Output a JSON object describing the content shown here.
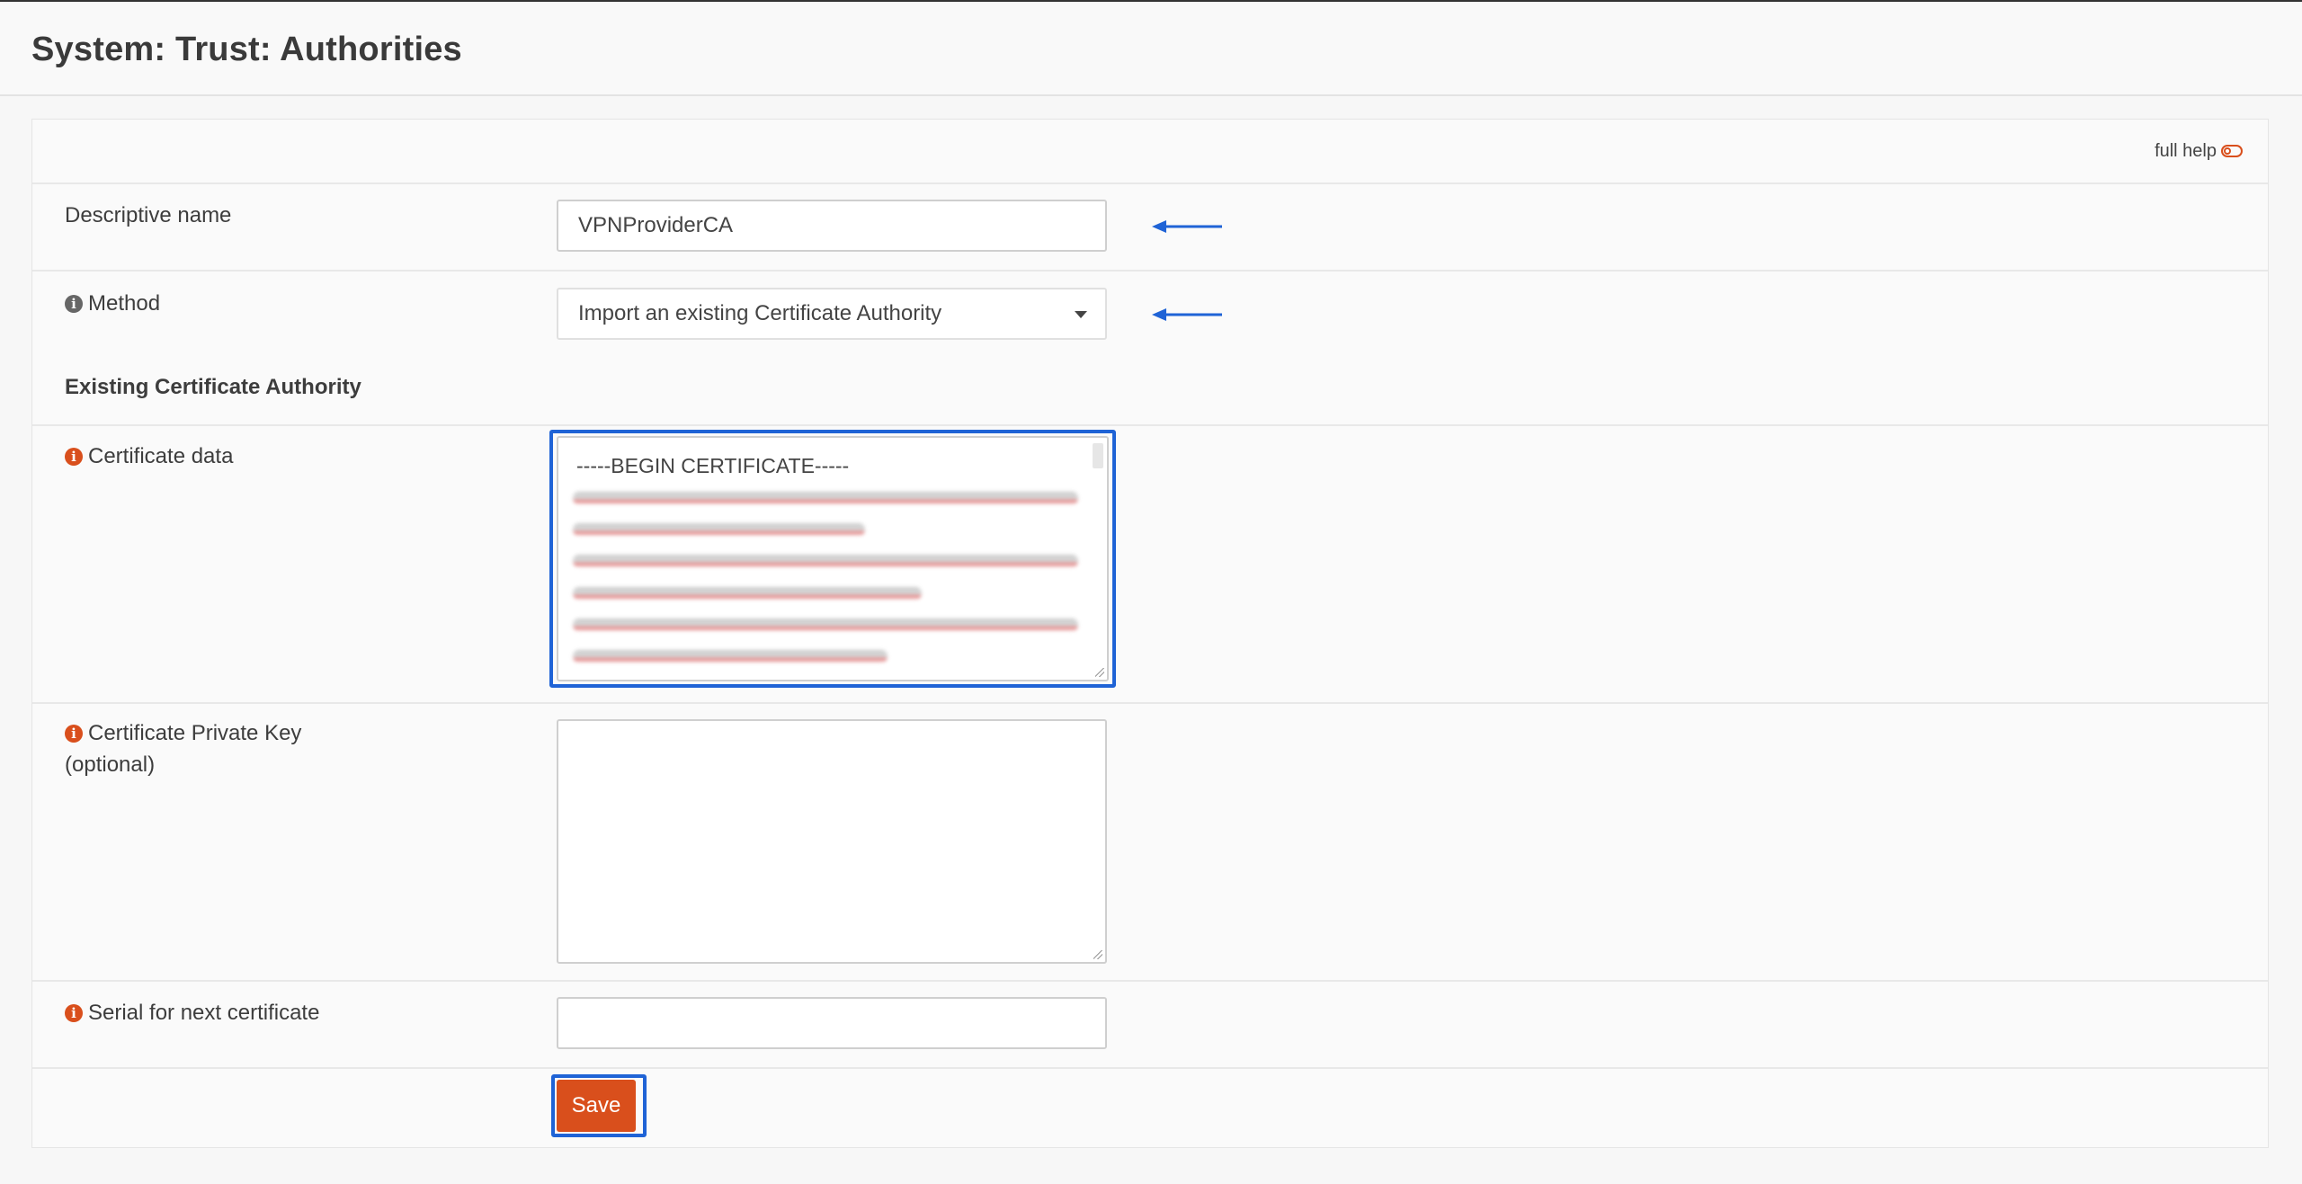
{
  "page": {
    "title": "System: Trust: Authorities"
  },
  "help": {
    "full_help_label": "full help"
  },
  "form": {
    "descriptive_name": {
      "label": "Descriptive name",
      "value": "VPNProviderCA"
    },
    "method": {
      "label": "Method",
      "selected": "Import an existing Certificate Authority"
    },
    "section_heading": "Existing Certificate Authority",
    "certificate_data": {
      "label": "Certificate data",
      "first_line": "-----BEGIN CERTIFICATE-----"
    },
    "private_key": {
      "label_line1": "Certificate Private Key",
      "label_line2": "(optional)",
      "value": ""
    },
    "serial": {
      "label": "Serial for next certificate",
      "value": ""
    },
    "save_label": "Save"
  },
  "colors": {
    "accent": "#d94f1c",
    "annotation": "#1f63d6",
    "info_icon_gray": "#666666"
  },
  "icons": {
    "info": "info-icon",
    "toggle": "toggle-icon",
    "dropdown": "chevron-down-icon",
    "annotation_arrow": "arrow-left-icon"
  }
}
